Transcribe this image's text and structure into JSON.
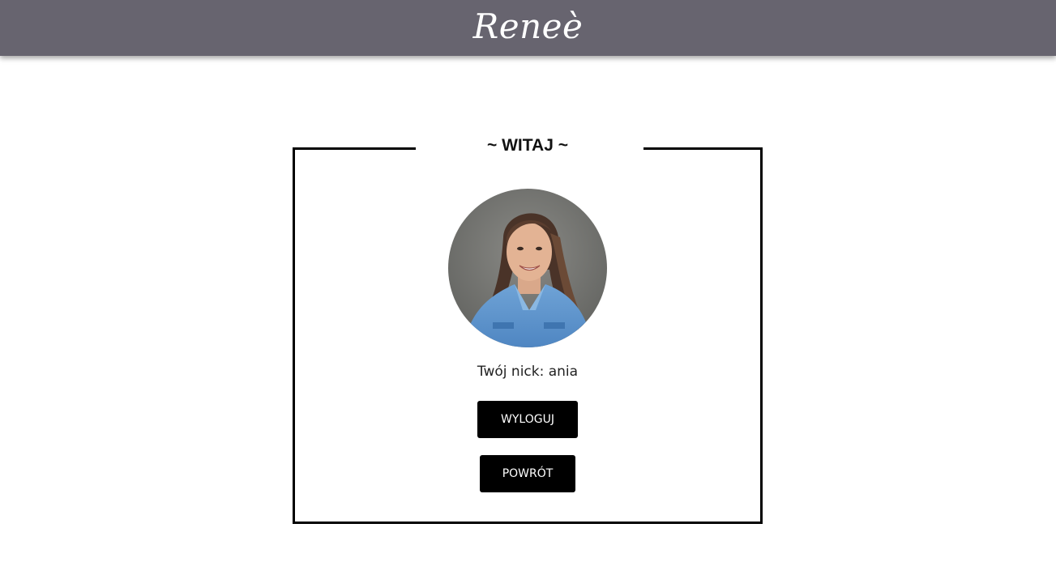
{
  "header": {
    "logo_text": "Reneè",
    "background_color": "#67646f"
  },
  "welcome_panel": {
    "title": "~ WITAJ ~",
    "avatar_alt": "profile-photo",
    "nick_label": "Twój nick: ania",
    "logout_label": "WYLOGUJ",
    "back_label": "POWRÓT"
  },
  "colors": {
    "button_bg": "#000000",
    "button_text": "#ffffff",
    "frame_border": "#000000"
  }
}
